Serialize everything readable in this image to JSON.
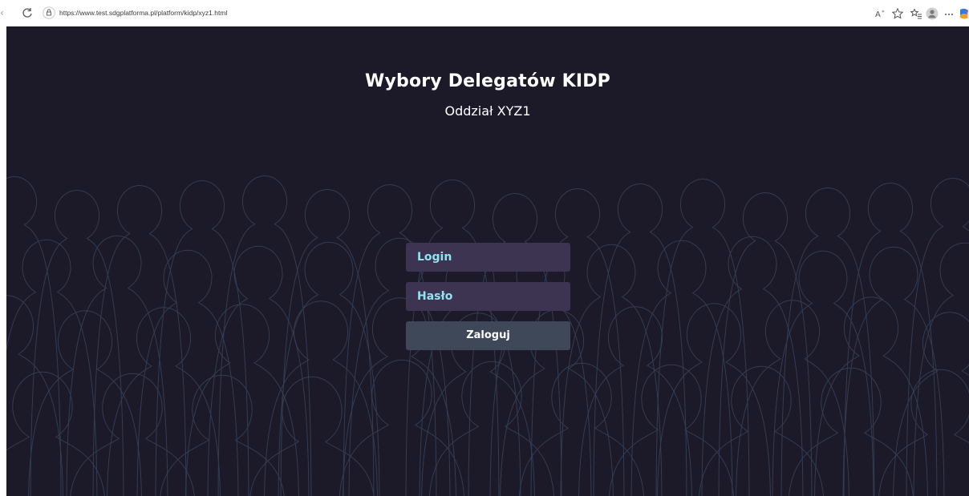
{
  "browser": {
    "url": "https://www.test.sdgplatforma.pl/platform/kidp/xyz1.html",
    "icons": [
      "back-icon",
      "reload-icon",
      "site-info-icon",
      "read-aloud-icon",
      "favorite-icon",
      "favorites-list-icon",
      "profile-icon",
      "more-icon",
      "copilot-icon"
    ]
  },
  "page": {
    "title": "Wybory Delegatów KIDP",
    "subtitle": "Oddział XYZ1",
    "background_color": "#1c1929",
    "accent_color": "#8fe3f2"
  },
  "form": {
    "login_placeholder": "Login",
    "password_placeholder": "Hasło",
    "submit_label": "Zaloguj"
  }
}
